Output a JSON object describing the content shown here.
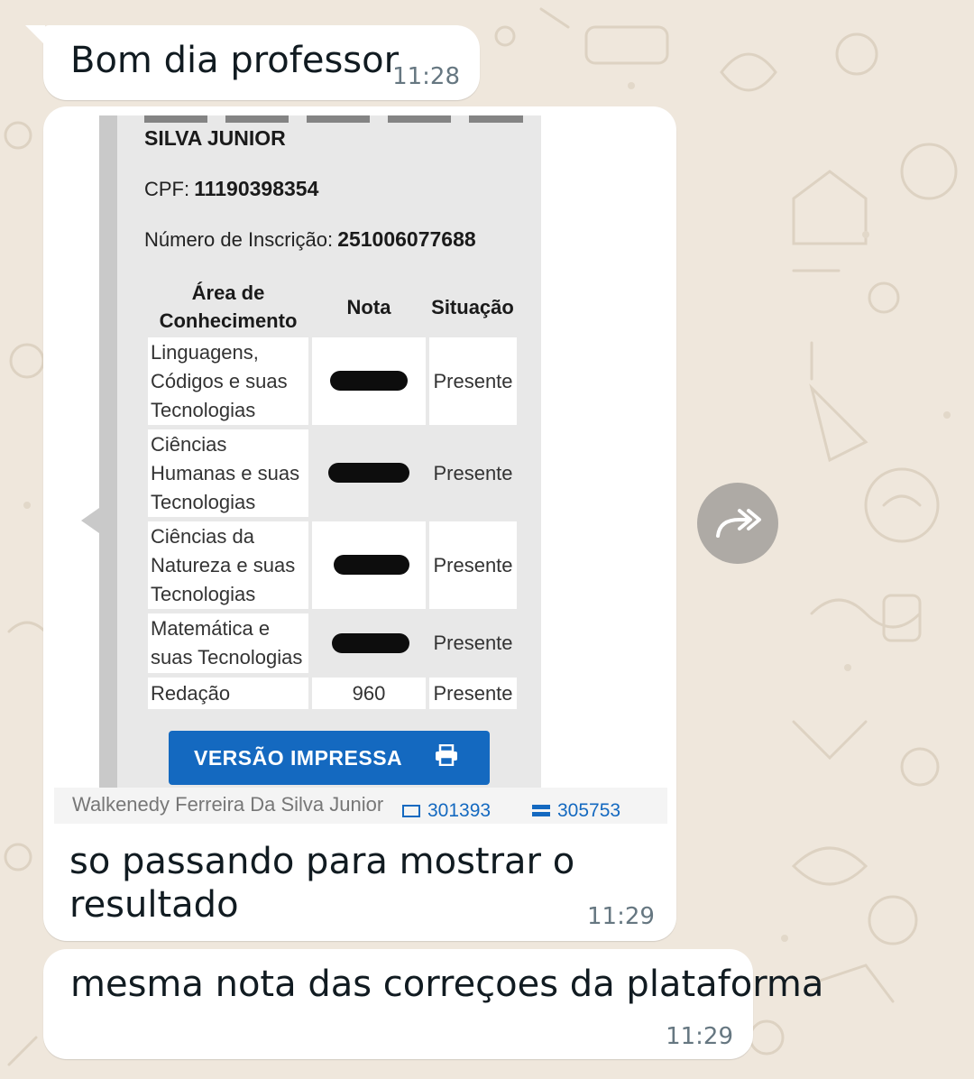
{
  "messages": [
    {
      "text": "Bom dia professor",
      "time": "11:28"
    },
    {
      "caption_line1": "so passando para mostrar o",
      "caption_line2": "resultado",
      "time": "11:29"
    },
    {
      "text": "mesma nota das correçoes da plataforma",
      "time": "11:29"
    }
  ],
  "screenshot": {
    "name_value": "SILVA JUNIOR",
    "cpf_label": "CPF:",
    "cpf_value": "11190398354",
    "inscricao_label": "Número de Inscrição:",
    "inscricao_value": "251006077688",
    "table": {
      "headers": {
        "area_line1": "Área de",
        "area_line2": "Conhecimento",
        "nota": "Nota",
        "situacao": "Situação"
      },
      "rows": [
        {
          "area": [
            "Linguagens,",
            "Códigos e suas",
            "Tecnologias"
          ],
          "nota": "",
          "situacao": "Presente"
        },
        {
          "area": [
            "Ciências",
            "Humanas e suas",
            "Tecnologias"
          ],
          "nota": "",
          "situacao": "Presente"
        },
        {
          "area": [
            "Ciências da",
            "Natureza e suas",
            "Tecnologias"
          ],
          "nota": "",
          "situacao": "Presente"
        },
        {
          "area": [
            "Matemática e",
            "suas Tecnologias"
          ],
          "nota": "",
          "situacao": "Presente"
        },
        {
          "area": [
            "Redação"
          ],
          "nota": "960",
          "situacao": "Presente"
        }
      ]
    },
    "print_button_label": "VERSÃO IMPRESSA",
    "footer": {
      "name": "Walkenedy Ferreira Da Silva Junior",
      "stat1": "301393",
      "stat2": "305753"
    }
  },
  "colors": {
    "wallpaper": "#efe7dc",
    "bubble": "#ffffff",
    "accent_blue": "#1469c0"
  },
  "icons": {
    "forward": "forward-arrow-icon",
    "print": "printer-icon"
  }
}
